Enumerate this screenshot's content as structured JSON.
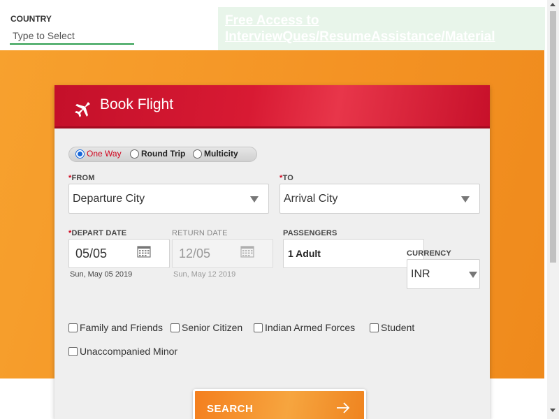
{
  "top": {
    "country_label": "COUNTRY",
    "country_placeholder": "Type to Select",
    "promo_text": "Free Access to InterviewQues/ResumeAssistance/Material"
  },
  "booking": {
    "title": "Book Flight",
    "trip_types": [
      {
        "label": "One Way",
        "selected": true
      },
      {
        "label": "Round Trip",
        "selected": false
      },
      {
        "label": "Multicity",
        "selected": false
      }
    ],
    "from": {
      "required_mark": "*",
      "label": "FROM",
      "value": "Departure City"
    },
    "to": {
      "required_mark": "*",
      "label": "TO",
      "value": "Arrival City"
    },
    "depart": {
      "required_mark": "*",
      "label": "DEPART DATE",
      "value": "05/05",
      "subtext": "Sun, May 05 2019"
    },
    "return": {
      "label": "RETURN DATE",
      "value": "12/05",
      "subtext": "Sun, May 12 2019"
    },
    "passengers": {
      "label": "PASSENGERS",
      "value": "1 Adult"
    },
    "currency": {
      "label": "CURRENCY",
      "value": "INR"
    },
    "concessions": [
      {
        "label": "Family and Friends",
        "checked": false
      },
      {
        "label": "Senior Citizen",
        "checked": false
      },
      {
        "label": "Indian Armed Forces",
        "checked": false
      },
      {
        "label": "Student",
        "checked": false
      },
      {
        "label": "Unaccompanied Minor",
        "checked": false
      }
    ],
    "search_label": "SEARCH"
  },
  "icons": {
    "plane": "airplane-icon",
    "calendar": "calendar-icon",
    "dropdown": "chevron-down-icon",
    "search_arrow": "arrow-right-icon"
  },
  "colors": {
    "accent_red": "#d0021b",
    "header_red": "#c4102a",
    "orange": "#f49324",
    "radio_blue": "#1565d8",
    "underline_green": "#2e9e4f"
  }
}
